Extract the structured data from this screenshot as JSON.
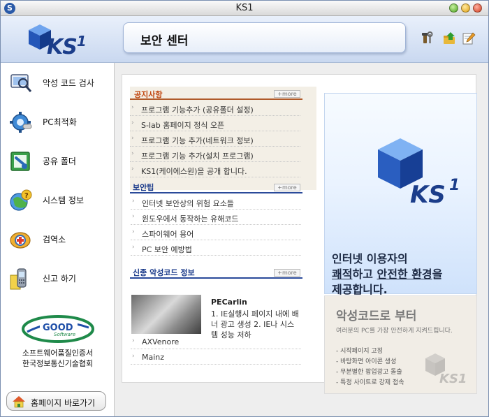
{
  "window": {
    "title": "KS1",
    "app_icon_letter": "S"
  },
  "header": {
    "logo_text": "KS",
    "logo_superscript": "1",
    "page_title": "보안 센터",
    "icons": [
      "tools-icon",
      "upload-icon",
      "edit-icon"
    ]
  },
  "sidebar": {
    "items": [
      {
        "label": "악성 코드 검사",
        "icon": "magnifier-icon"
      },
      {
        "label": "PC최적화",
        "icon": "gear-icon"
      },
      {
        "label": "공유 폴더",
        "icon": "shared-folder-icon"
      },
      {
        "label": "시스템 정보",
        "icon": "system-info-icon"
      },
      {
        "label": "검역소",
        "icon": "quarantine-icon"
      },
      {
        "label": "신고 하기",
        "icon": "report-icon"
      }
    ],
    "cert_logo_text": "GOOD",
    "cert_logo_subtext": "Software",
    "cert_line1": "소프트웨어품질인증서",
    "cert_line2": "한국정보통신기술협회",
    "home_button": "홈페이지 바로가기"
  },
  "notices": {
    "title": "공지사항",
    "more": "+more",
    "items": [
      "프로그램 기능추가 (공유폴더 설정)",
      "S-lab 홈페이지 정식 오픈",
      "프로그램 기능 추가(네트워크 정보)",
      "프로그램 기능 추가(설치 프로그램)",
      "KS1(케이에스원)을 공개 합니다."
    ]
  },
  "security_tips": {
    "title": "보안팁",
    "more": "+more",
    "items": [
      "인터넷 보안상의 위험 요소들",
      "윈도우에서 동작하는 유해코드",
      "스파이웨어 용어",
      "PC 보안 예방법"
    ]
  },
  "new_malware": {
    "title": "신종 악성코드 정보",
    "more": "+more",
    "featured_name": "PECarlin",
    "featured_desc": "1. IE실행시 페이지 내에 배너 광고 생성 2. IE나 시스템 성능 저하",
    "items": [
      "AXVenore",
      "Mainz"
    ]
  },
  "banner": {
    "line1": "인터넷 이용자의",
    "line2_a": "쾌적",
    "line2_b": "하고 ",
    "line2_c": "안전한 환경",
    "line2_d": "을",
    "line3": "제공합니다."
  },
  "promo": {
    "title": "악성코드로 부터",
    "subtitle": "여러분의 PC를 가장 안전하게 지켜드립니다.",
    "features": [
      "- 시작페이지 고정",
      "- 바탕화면 아이콘 생성",
      "- 무분별한 팝업광고 돌출",
      "- 특정 사이트로 강제 접속"
    ]
  },
  "colors": {
    "notice_title": "#c0440c",
    "tips_title": "#1a3a8a",
    "malware_title": "#1a3a8a",
    "notice_rule": "#b05a2a",
    "tips_rule": "#2a4a9a",
    "brand_blue": "#1b3d8a"
  }
}
